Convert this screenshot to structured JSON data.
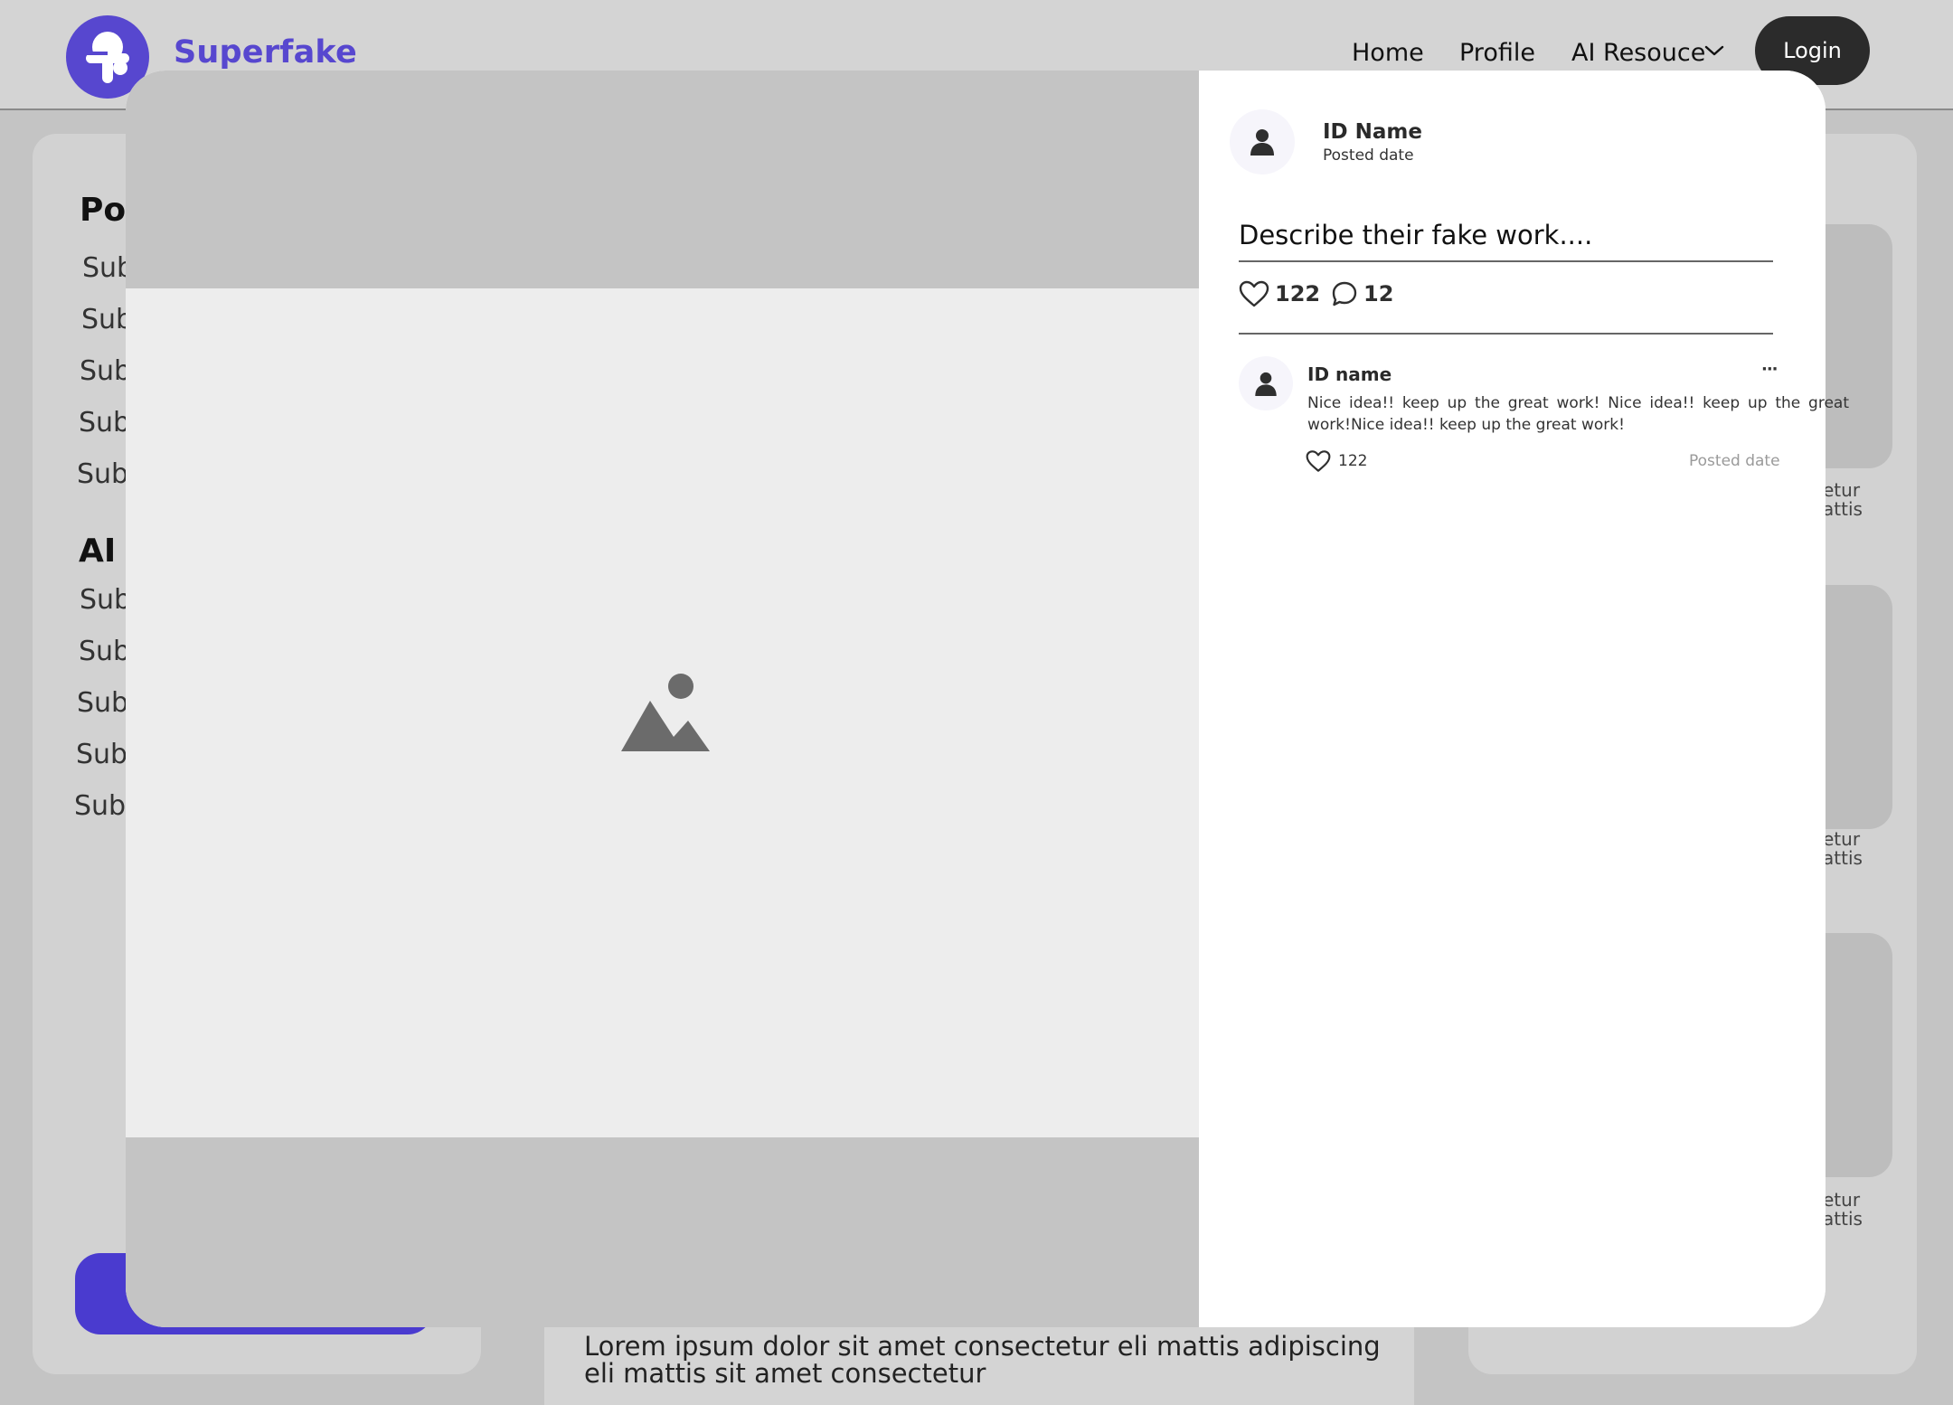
{
  "header": {
    "brand": "Superfake",
    "nav": {
      "home": "Home",
      "profile": "Profile",
      "ai_resource": "AI Resouce"
    },
    "login": "Login"
  },
  "left_panel": {
    "heading_1": "Pop",
    "heading_2": "AI T",
    "sub_items": [
      "Sub",
      "Sub",
      "Sub",
      "Sub",
      "Sub",
      "Sub",
      "Sub",
      "Sub",
      "Sub",
      "Sub"
    ]
  },
  "right_panel": {
    "card_texts": [
      {
        "line1": "etur",
        "line2": "attis"
      },
      {
        "line1": "etur",
        "line2": "attis"
      },
      {
        "line1": "etur",
        "line2": "attis"
      }
    ]
  },
  "center": {
    "text": "Lorem ipsum dolor sit amet consectetur eli mattis adipiscing eli mattis sit amet consectetur"
  },
  "post": {
    "author": "ID Name",
    "date": "Posted date",
    "description": "Describe their fake work....",
    "likes": "122",
    "comments": "12"
  },
  "comment": {
    "author": "ID name",
    "menu": "···",
    "text": "Nice idea!! keep up the great work! Nice idea!! keep up the great work!Nice idea!! keep up the great work!",
    "likes": "122",
    "date": "Posted date"
  },
  "colors": {
    "brand": "#5747cf",
    "overlay": "#c4c4c4",
    "login_bg": "#2b2b2b"
  }
}
